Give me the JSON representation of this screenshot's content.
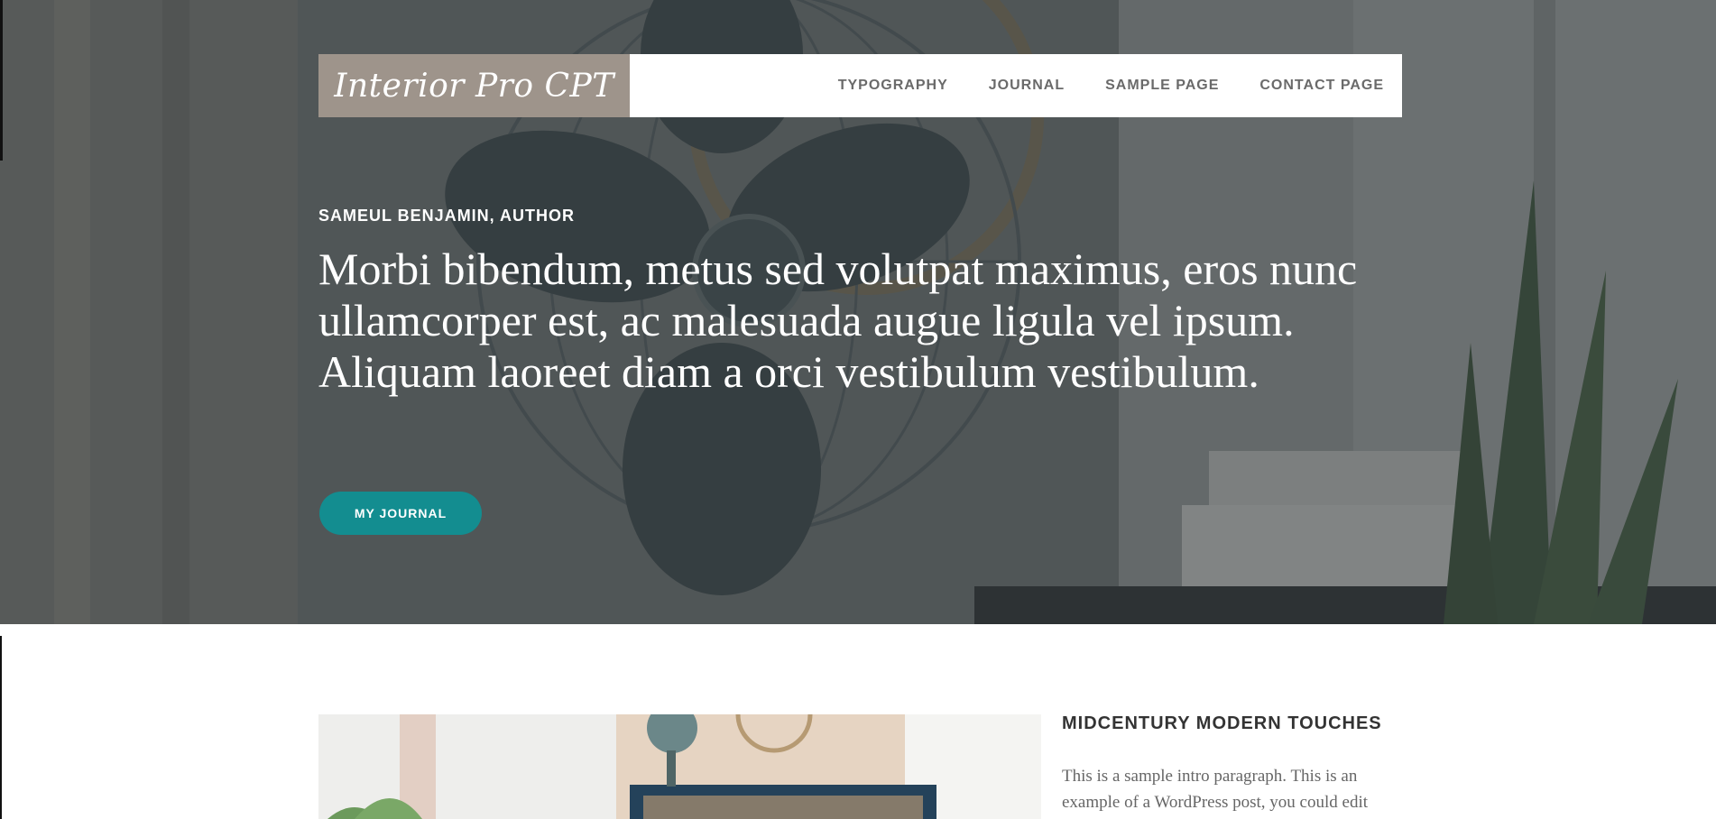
{
  "header": {
    "logo": "Interior Pro CPT",
    "nav": [
      {
        "label": "TYPOGRAPHY"
      },
      {
        "label": "JOURNAL"
      },
      {
        "label": "SAMPLE PAGE"
      },
      {
        "label": "CONTACT PAGE"
      }
    ]
  },
  "hero": {
    "author": "SAMEUL BENJAMIN, AUTHOR",
    "heading": "Morbi bibendum, metus sed volutpat maximus, eros nunc ullamcorper est, ac malesuada augue ligula vel ipsum. Aliquam laoreet diam a orci vestibulum vestibulum.",
    "button_label": "MY JOURNAL"
  },
  "post": {
    "title": "MIDCENTURY MODERN TOUCHES",
    "excerpt": "This is a sample intro paragraph. This is an example of a WordPress post, you could edit"
  },
  "colors": {
    "accent": "#138d90",
    "logo_bg": "#9e948b",
    "nav_text": "#6a6a6a"
  }
}
